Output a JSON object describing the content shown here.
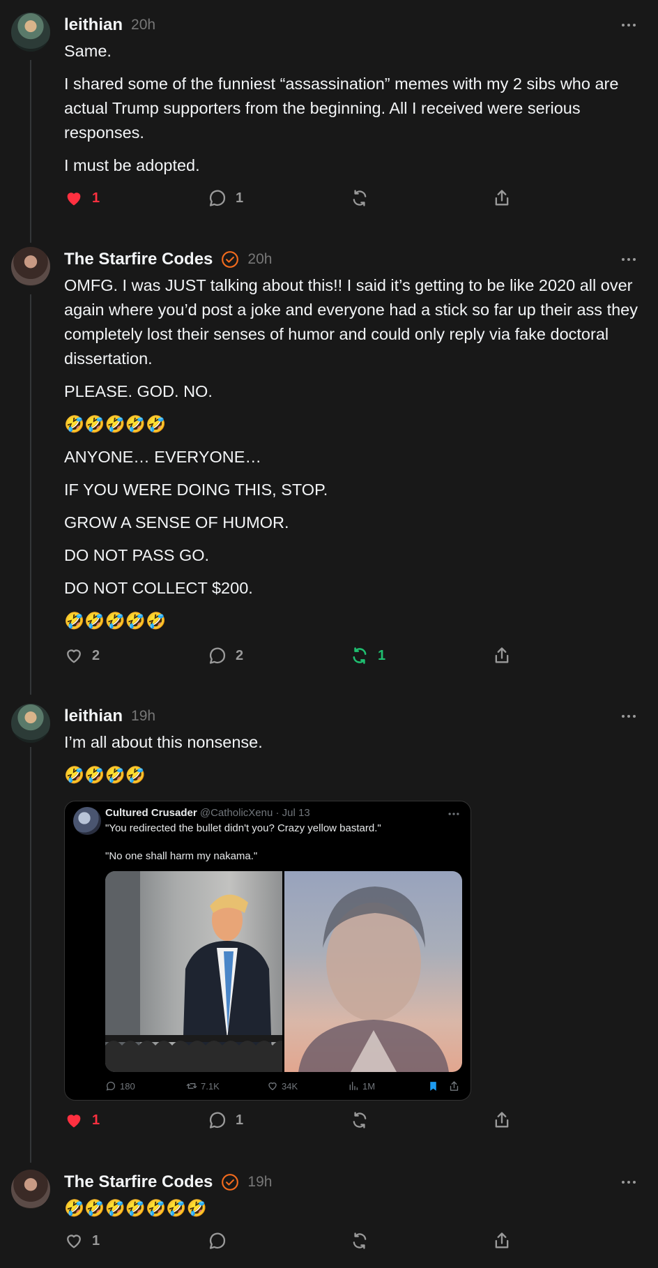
{
  "posts": [
    {
      "username": "leithian",
      "time": "20h",
      "paragraphs": [
        "Same.",
        "I shared some of the funniest “assassination” memes with my 2 sibs who are actual Trump supporters from the beginning. All I received were serious responses.",
        "I must be adopted."
      ],
      "likes": "1",
      "replies": "1",
      "reposts": "",
      "liked": true
    },
    {
      "username": "The Starfire Codes",
      "time": "20h",
      "paragraphs": [
        "OMFG. I was JUST talking about this!! I said it’s getting to be like 2020 all over again where you’d post a joke and everyone had a stick so far up their ass they completely lost their senses of humor and could only reply via fake doctoral dissertation.",
        "PLEASE. GOD. NO.",
        "🤣🤣🤣🤣🤣",
        "ANYONE… EVERYONE…",
        "IF YOU WERE DOING THIS, STOP.",
        "GROW A SENSE OF HUMOR.",
        "DO NOT PASS GO.",
        "DO NOT COLLECT $200.",
        "🤣🤣🤣🤣🤣"
      ],
      "likes": "2",
      "replies": "2",
      "reposts": "1",
      "reposted": true
    },
    {
      "username": "leithian",
      "time": "19h",
      "paragraphs": [
        "I’m all about this nonsense.",
        "🤣🤣🤣🤣"
      ],
      "likes": "1",
      "replies": "1",
      "reposts": "",
      "liked": true,
      "embed": {
        "name": "Cultured Crusader",
        "handle": "@CatholicXenu",
        "date": "· Jul 13",
        "line1": "\"You redirected the bullet didn't you? Crazy yellow bastard.\"",
        "line2": "\"No one shall harm my nakama.\"",
        "replies": "180",
        "retweets": "7.1K",
        "likes": "34K",
        "views": "1M"
      }
    },
    {
      "username": "The Starfire Codes",
      "time": "19h",
      "paragraphs": [
        "🤣🤣🤣🤣🤣🤣🤣"
      ],
      "likes": "1",
      "replies": "",
      "reposts": ""
    }
  ],
  "colors": {
    "background": "#181818",
    "like": "#ff3040",
    "repost": "#1fbf70",
    "verified": "#f26b1d",
    "bookmark": "#1d9bf0"
  },
  "icons": [
    "more-icon",
    "heart-icon",
    "reply-icon",
    "repost-icon",
    "share-icon",
    "verified-icon",
    "bookmark-icon",
    "views-icon"
  ]
}
